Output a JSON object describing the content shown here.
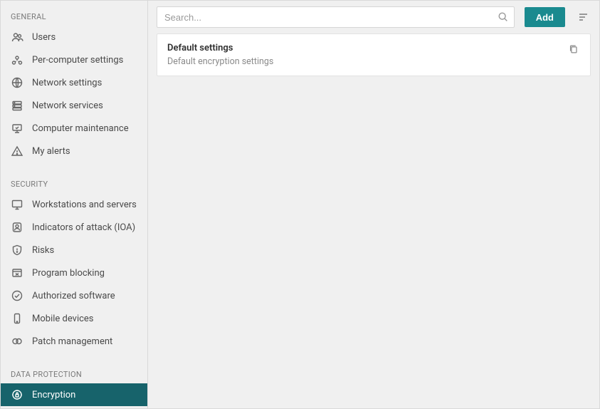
{
  "sidebar": {
    "sections": [
      {
        "header": "GENERAL",
        "items": [
          {
            "id": "users",
            "label": "Users",
            "icon": "users"
          },
          {
            "id": "per-computer",
            "label": "Per-computer settings",
            "icon": "per-computer"
          },
          {
            "id": "network-settings",
            "label": "Network settings",
            "icon": "globe"
          },
          {
            "id": "network-services",
            "label": "Network services",
            "icon": "server"
          },
          {
            "id": "computer-maintenance",
            "label": "Computer maintenance",
            "icon": "wrench-screen"
          },
          {
            "id": "my-alerts",
            "label": "My alerts",
            "icon": "alert"
          }
        ]
      },
      {
        "header": "SECURITY",
        "items": [
          {
            "id": "workstations",
            "label": "Workstations and servers",
            "icon": "monitor"
          },
          {
            "id": "ioa",
            "label": "Indicators of attack (IOA)",
            "icon": "fingerprint"
          },
          {
            "id": "risks",
            "label": "Risks",
            "icon": "shield-alert"
          },
          {
            "id": "program-blocking",
            "label": "Program blocking",
            "icon": "window-x"
          },
          {
            "id": "authorized",
            "label": "Authorized software",
            "icon": "check-circle"
          },
          {
            "id": "mobile",
            "label": "Mobile devices",
            "icon": "smartphone"
          },
          {
            "id": "patch",
            "label": "Patch management",
            "icon": "patch"
          }
        ]
      },
      {
        "header": "DATA PROTECTION",
        "items": [
          {
            "id": "encryption",
            "label": "Encryption",
            "icon": "lock-gear",
            "active": true
          }
        ]
      }
    ]
  },
  "toolbar": {
    "search_placeholder": "Search...",
    "add_label": "Add"
  },
  "list": {
    "items": [
      {
        "title": "Default settings",
        "subtitle": "Default encryption settings"
      }
    ]
  }
}
